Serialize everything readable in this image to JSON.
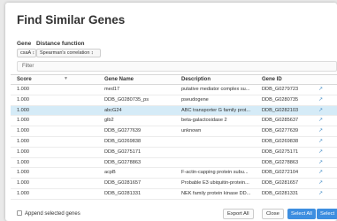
{
  "dialog": {
    "title": "Find Similar Genes",
    "gene_label": "Gene",
    "gene_value": "csaA ↕",
    "distance_label": "Distance function",
    "distance_value": "Spearman's correlation ↕",
    "filter_placeholder": "Filter"
  },
  "table": {
    "columns": [
      "Score",
      "Gene Name",
      "Description",
      "Gene ID"
    ],
    "rows": [
      {
        "score": "1.000",
        "name": "med17",
        "desc": "putative mediator complex su...",
        "id": "DDB_G0279723",
        "selected": false
      },
      {
        "score": "1.000",
        "name": "DDB_G0280735_ps",
        "desc": "pseudogene",
        "id": "DDB_G0280735",
        "selected": false
      },
      {
        "score": "1.000",
        "name": "abcG24",
        "desc": "ABC transporter G family prot...",
        "id": "DDB_G0282103",
        "selected": true
      },
      {
        "score": "1.000",
        "name": "glb2",
        "desc": "beta-galactosidase 2",
        "id": "DDB_G0285637",
        "selected": false
      },
      {
        "score": "1.000",
        "name": "DDB_G0277639",
        "desc": "unknown",
        "id": "DDB_G0277639",
        "selected": false
      },
      {
        "score": "1.000",
        "name": "DDB_G0269838",
        "desc": "",
        "id": "DDB_G0269838",
        "selected": false
      },
      {
        "score": "1.000",
        "name": "DDB_G0275171",
        "desc": "",
        "id": "DDB_G0275171",
        "selected": false
      },
      {
        "score": "1.000",
        "name": "DDB_G0278863",
        "desc": "",
        "id": "DDB_G0278863",
        "selected": false
      },
      {
        "score": "1.000",
        "name": "acpB",
        "desc": "F-actin-capping protein subu...",
        "id": "DDB_G0272104",
        "selected": false
      },
      {
        "score": "1.000",
        "name": "DDB_G0281657",
        "desc": "Probable E3 ubiquitin-protein...",
        "id": "DDB_G0281657",
        "selected": false
      },
      {
        "score": "1.000",
        "name": "DDB_G0281331",
        "desc": "NEK family protein kinase DD...",
        "id": "DDB_G0281331",
        "selected": false
      }
    ],
    "link_icon": "external-link-icon"
  },
  "footer": {
    "append_label": "Append selected genes",
    "export_label": "Export All",
    "close_label": "Close",
    "select_all_label": "Select All",
    "select_label": "Select"
  },
  "colors": {
    "accent": "#3d8ee0",
    "selected_row": "#d5ebf7"
  }
}
